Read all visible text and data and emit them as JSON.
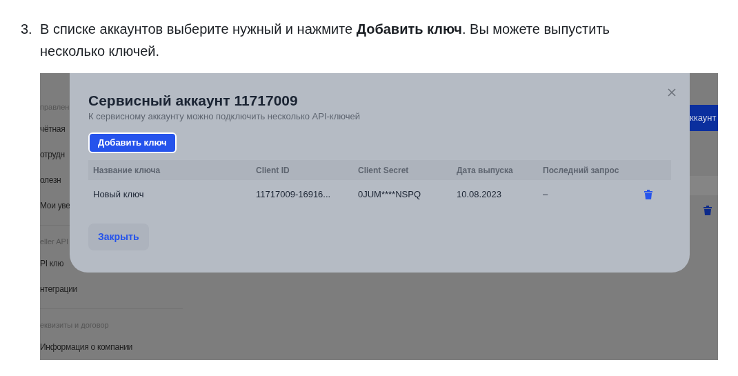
{
  "instruction": {
    "number": "3.",
    "text": "В списке аккаунтов выберите нужный и нажмите **Добавить ключ**. Вы можете выпустить несколько ключей."
  },
  "screenshot": {
    "sidebar": [
      {
        "kind": "heading",
        "label": "правлен"
      },
      {
        "kind": "item",
        "label": "чётная"
      },
      {
        "kind": "item",
        "label": "отрудн"
      },
      {
        "kind": "item",
        "label": "олезн"
      },
      {
        "kind": "item",
        "label": "Мои уве"
      },
      {
        "kind": "divider"
      },
      {
        "kind": "heading",
        "label": "eller API"
      },
      {
        "kind": "item",
        "label": "PI клю"
      },
      {
        "kind": "item",
        "label": "нтеграции"
      },
      {
        "kind": "divider"
      },
      {
        "kind": "heading",
        "label": "еквизиты и договор"
      },
      {
        "kind": "item",
        "label": "Информация о компании"
      }
    ],
    "background_button": "ккаунт",
    "modal": {
      "title": "Сервисный аккаунт 11717009",
      "subtitle": "К сервисному аккаунту можно подключить несколько API-ключей",
      "add_button": "Добавить ключ",
      "columns": [
        "Название ключа",
        "Client ID",
        "Client Secret",
        "Дата выпуска",
        "Последний запрос"
      ],
      "rows": [
        {
          "cells": [
            "Новый ключ",
            "11717009-16916...",
            "0JUM****NSPQ",
            "10.08.2023",
            "–"
          ]
        }
      ],
      "close_button": "Закрыть"
    }
  }
}
